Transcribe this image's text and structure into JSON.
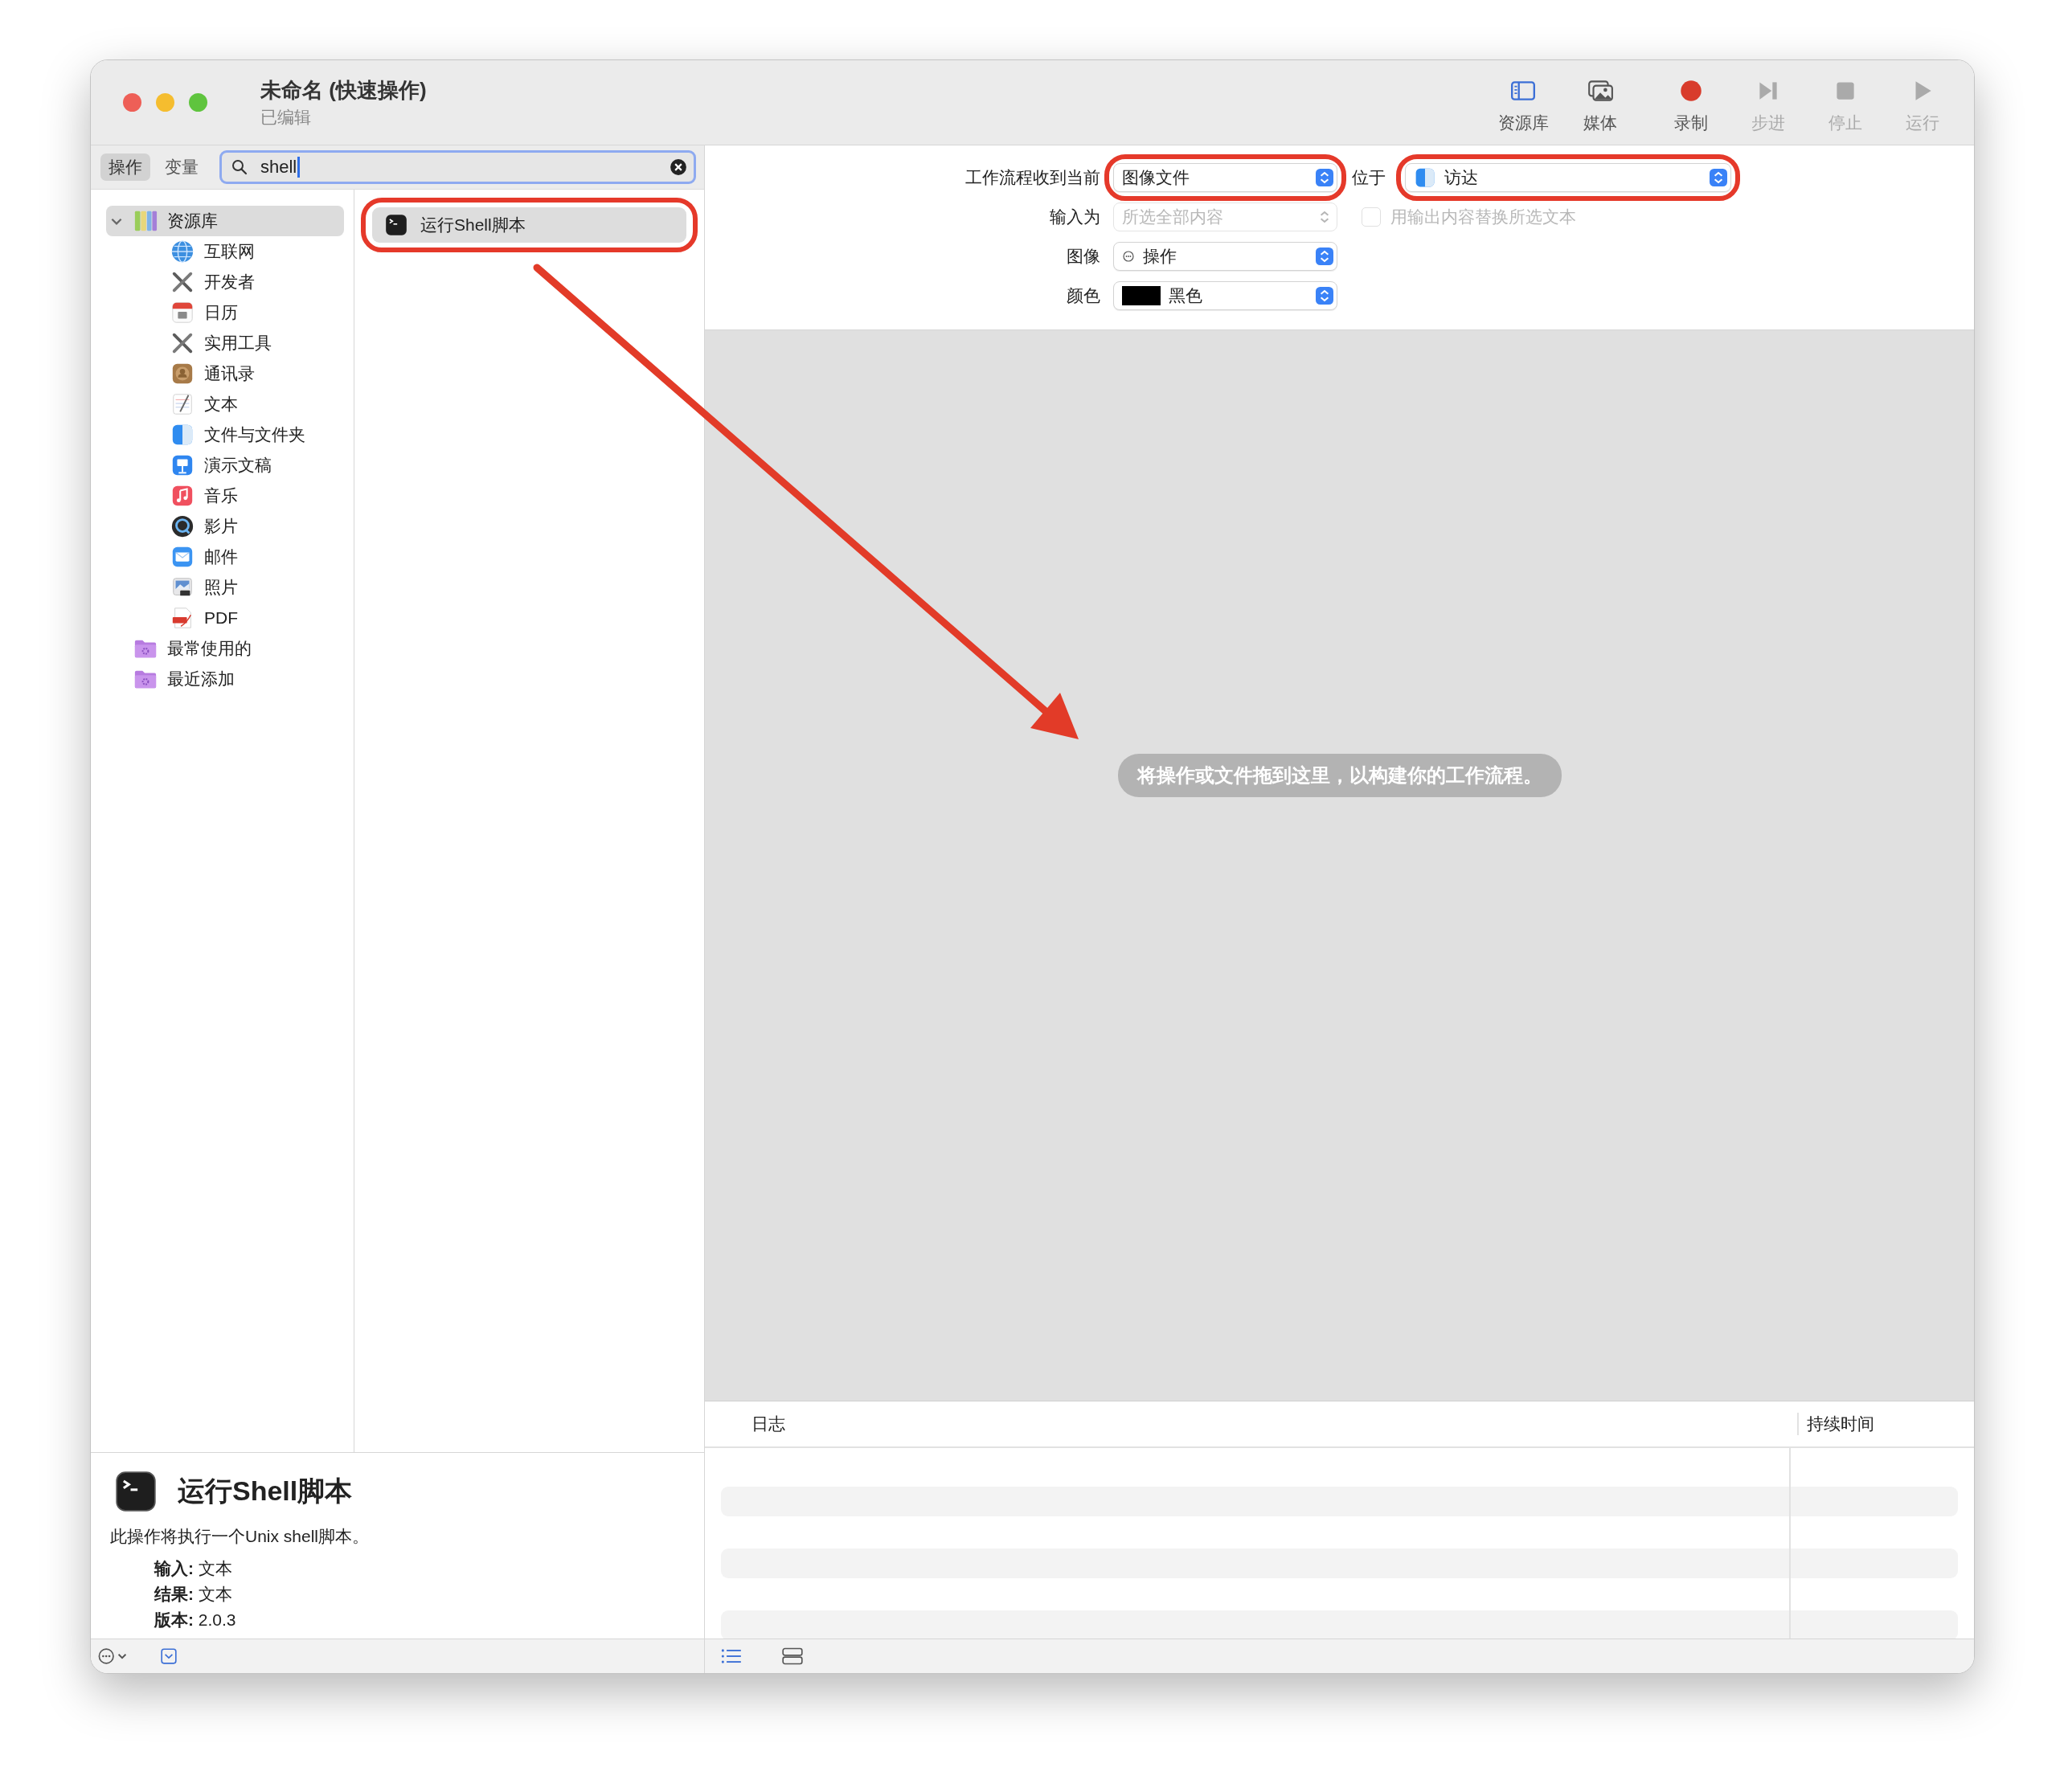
{
  "window": {
    "title": "未命名 (快速操作)",
    "subtitle": "已编辑"
  },
  "toolbar": [
    {
      "label": "资源库",
      "kind": "library",
      "disabled": false
    },
    {
      "label": "媒体",
      "kind": "media",
      "disabled": false
    },
    {
      "label": "录制",
      "kind": "record",
      "disabled": false
    },
    {
      "label": "步进",
      "kind": "step",
      "disabled": true
    },
    {
      "label": "停止",
      "kind": "stop",
      "disabled": true
    },
    {
      "label": "运行",
      "kind": "run",
      "disabled": true
    }
  ],
  "library_tabs": [
    {
      "label": "操作",
      "selected": true
    },
    {
      "label": "变量",
      "selected": false
    }
  ],
  "search": {
    "value": "shell"
  },
  "library_tree": [
    {
      "label": "资源库",
      "kind": "library",
      "expanded": true,
      "selected": true,
      "children": [
        {
          "label": "互联网",
          "kind": "globe"
        },
        {
          "label": "开发者",
          "kind": "tools"
        },
        {
          "label": "日历",
          "kind": "calendar"
        },
        {
          "label": "实用工具",
          "kind": "tools"
        },
        {
          "label": "通讯录",
          "kind": "contacts"
        },
        {
          "label": "文本",
          "kind": "text"
        },
        {
          "label": "文件与文件夹",
          "kind": "finder"
        },
        {
          "label": "演示文稿",
          "kind": "keynote"
        },
        {
          "label": "音乐",
          "kind": "music"
        },
        {
          "label": "影片",
          "kind": "movie"
        },
        {
          "label": "邮件",
          "kind": "mail"
        },
        {
          "label": "照片",
          "kind": "photos"
        },
        {
          "label": "PDF",
          "kind": "pdf"
        }
      ]
    },
    {
      "label": "最常使用的",
      "kind": "smart-folder",
      "selected": false
    },
    {
      "label": "最近添加",
      "kind": "smart-folder",
      "selected": false
    }
  ],
  "actions": [
    {
      "label": "运行Shell脚本",
      "selected": true,
      "annotated": true
    }
  ],
  "description": {
    "title": "运行Shell脚本",
    "text": "此操作将执行一个Unix shell脚本。",
    "details": [
      "**输入:** 文本",
      "**结果:** 文本",
      "**版本:** 2.0.3"
    ]
  },
  "config": [
    {
      "kind": "popup",
      "label": "工作流程收到当前",
      "value": "图像文件",
      "annotated": true,
      "disabled": false,
      "side": {
        "kind": "finder-popup",
        "label": "位于",
        "value": "访达",
        "annotated": true,
        "disabled": false
      }
    },
    {
      "kind": "popup",
      "label": "输入为",
      "value": "所选全部内容",
      "annotated": false,
      "disabled": true,
      "side": {
        "kind": "checkbox",
        "label": "用输出内容替换所选文本",
        "checked": false,
        "disabled": true
      }
    },
    {
      "kind": "dots-popup",
      "label": "图像",
      "value": "操作",
      "annotated": false,
      "disabled": false
    },
    {
      "kind": "swatch-popup",
      "label": "颜色",
      "value": "黑色",
      "annotated": false,
      "disabled": false
    }
  ],
  "drop_hint": "将操作或文件拖到这里，以构建你的工作流程。",
  "log": {
    "columns": [
      "日志",
      "持续时间"
    ]
  },
  "annotation_arrow": true
}
